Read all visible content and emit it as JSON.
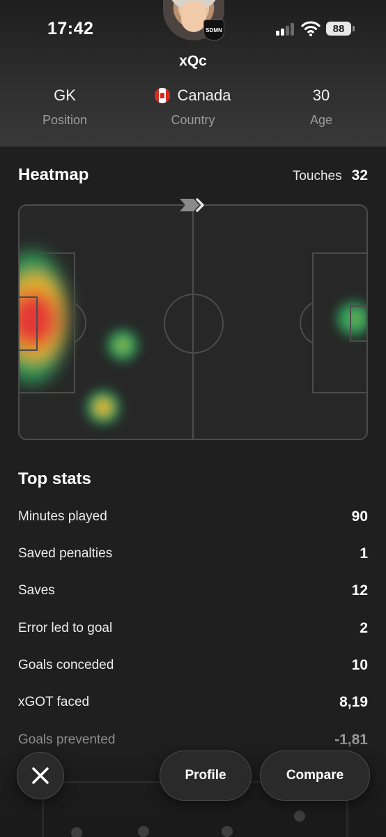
{
  "status_bar": {
    "time": "17:42",
    "battery": "88"
  },
  "player": {
    "badge": "SDMN",
    "name": "xQc",
    "info": [
      {
        "value": "GK",
        "label": "Position"
      },
      {
        "value": "Canada",
        "label": "Country",
        "flag": "canada-flag-icon"
      },
      {
        "value": "30",
        "label": "Age"
      }
    ]
  },
  "heatmap": {
    "title": "Heatmap",
    "touches_label": "Touches",
    "touches_value": "32",
    "direction_icon": "chevron-right-icon"
  },
  "top_stats": {
    "title": "Top stats",
    "rows": [
      {
        "label": "Minutes played",
        "value": "90"
      },
      {
        "label": "Saved penalties",
        "value": "1"
      },
      {
        "label": "Saves",
        "value": "12"
      },
      {
        "label": "Error led to goal",
        "value": "2"
      },
      {
        "label": "Goals conceded",
        "value": "10"
      },
      {
        "label": "xGOT faced",
        "value": "8,19"
      },
      {
        "label": "Goals prevented",
        "value": "-1,81"
      }
    ]
  },
  "actions": {
    "close_icon": "close-icon",
    "profile_label": "Profile",
    "compare_label": "Compare"
  },
  "colors": {
    "background": "#1f1f1f",
    "heat_red": "#e53935",
    "heat_yellow": "#e8b923",
    "heat_green": "#2e9e5b"
  }
}
